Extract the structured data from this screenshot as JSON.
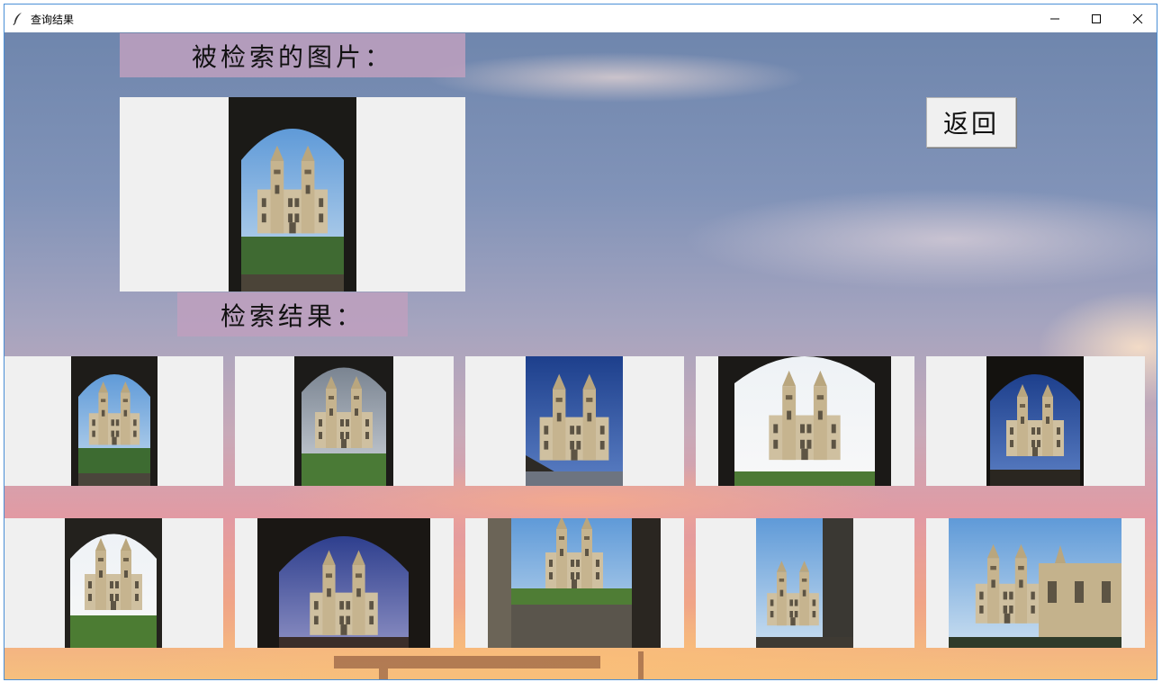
{
  "window": {
    "title": "查询结果",
    "icon": "feather-icon",
    "controls": [
      "minimize-icon",
      "maximize-icon",
      "close-icon"
    ]
  },
  "query_section": {
    "label": "被检索的图片："
  },
  "results_section": {
    "label": "检索结果："
  },
  "back_button": {
    "label": "返回"
  },
  "colors": {
    "panel_bg": "#f0f0f0",
    "label_bg": "#bea0be"
  }
}
